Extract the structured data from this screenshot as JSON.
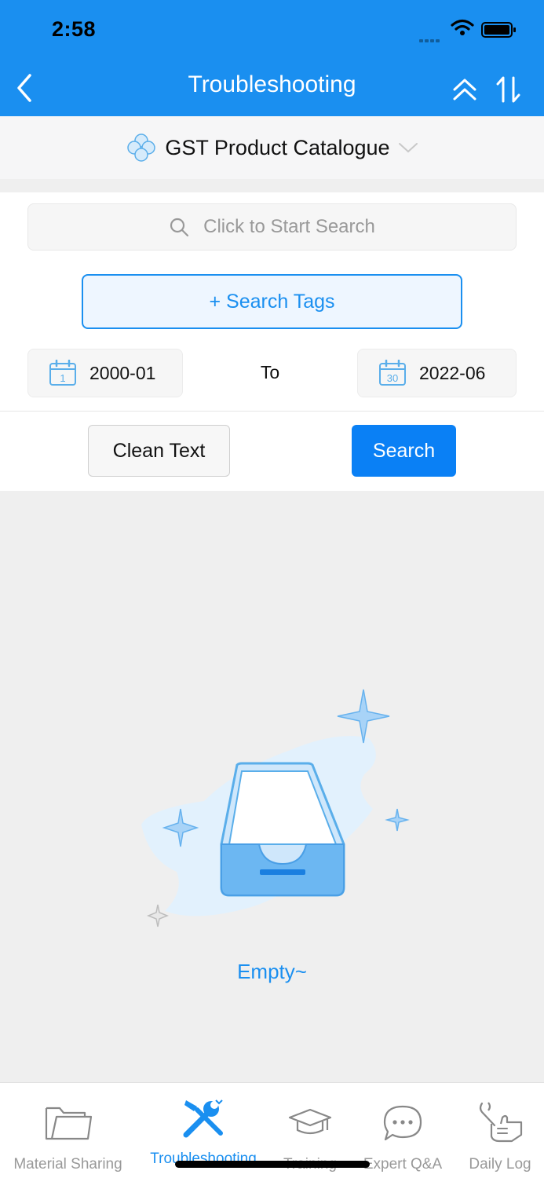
{
  "status_bar": {
    "time": "2:58"
  },
  "nav": {
    "title": "Troubleshooting"
  },
  "catalog": {
    "name": "GST Product Catalogue"
  },
  "search": {
    "placeholder": "Click to Start Search",
    "tags_button": "+ Search Tags"
  },
  "date_range": {
    "from": "2000-01",
    "to_label": "To",
    "to": "2022-06",
    "from_cal_day": "1",
    "to_cal_day": "30"
  },
  "actions": {
    "clean": "Clean Text",
    "search": "Search"
  },
  "empty": {
    "text": "Empty~"
  },
  "tabs": [
    {
      "label": "Material Sharing",
      "icon": "folder-icon",
      "active": false
    },
    {
      "label": "Troubleshooting",
      "icon": "tools-icon",
      "active": true
    },
    {
      "label": "Training",
      "icon": "graduation-cap-icon",
      "active": false
    },
    {
      "label": "Expert Q&A",
      "icon": "chat-bubble-icon",
      "active": false
    },
    {
      "label": "Daily Log",
      "icon": "wrench-hand-icon",
      "active": false
    }
  ],
  "colors": {
    "primary": "#1a8ff0",
    "search_button": "#0a80f5",
    "background": "#efefef"
  }
}
